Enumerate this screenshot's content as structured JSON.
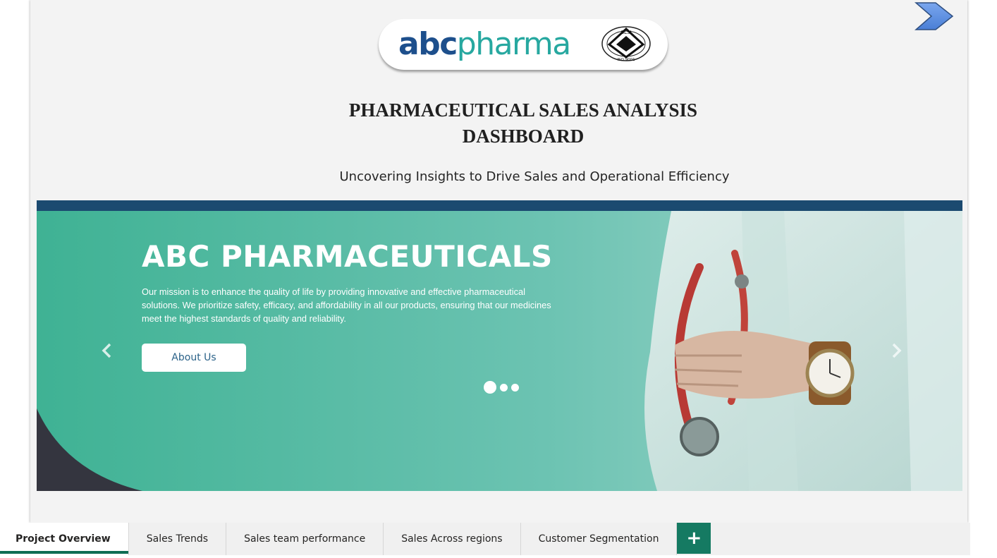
{
  "logo": {
    "abc": "abc",
    "pharma": "pharma",
    "seal_text_top": "SLSI",
    "seal_text_bottom": "ISO 9001"
  },
  "header": {
    "title_line1": "PHARMACEUTICAL SALES ANALYSIS",
    "title_line2": "DASHBOARD",
    "subtitle": "Uncovering Insights to Drive Sales and Operational Efficiency"
  },
  "banner": {
    "heading": "ABC PHARMACEUTICALS",
    "mission": "Our mission is to enhance the quality of life by providing innovative and effective pharmaceutical solutions. We prioritize safety, efficacy, and affordability in all our products, ensuring that our medicines meet the highest standards of quality and reliability.",
    "button_label": "About Us",
    "slide_count": 3,
    "active_slide": 1
  },
  "tabs": [
    {
      "label": "Project Overview",
      "active": true
    },
    {
      "label": "Sales Trends",
      "active": false
    },
    {
      "label": "Sales team performance",
      "active": false
    },
    {
      "label": "Sales Across regions",
      "active": false
    },
    {
      "label": "Customer Segmentation",
      "active": false
    }
  ],
  "add_tab_label": "+",
  "colors": {
    "accent": "#157a62",
    "brand_blue": "#1d4f8c",
    "brand_teal": "#27a8a0",
    "banner_teal": "#5cbfad",
    "banner_topbar": "#1b4a70",
    "next_arrow": "#5b8fe0"
  },
  "icons": {
    "next_page": "chevron-right-icon",
    "carousel_prev": "chevron-left-icon",
    "carousel_next": "chevron-right-icon",
    "add_page": "plus-icon"
  }
}
